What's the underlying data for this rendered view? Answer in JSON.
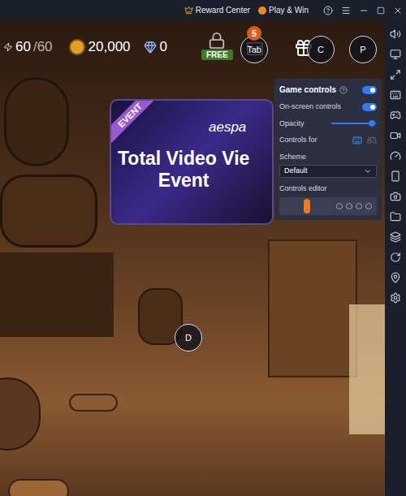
{
  "topbar": {
    "items": [
      {
        "label": "Reward Center"
      },
      {
        "label": "Play & Win"
      }
    ]
  },
  "hud": {
    "stamina": "60",
    "stamina_max": "/60",
    "gold": "20,000",
    "crystals": "0",
    "pack": "FREE",
    "mail_badge": "5"
  },
  "keys": [
    {
      "label": "Tab"
    },
    {
      "label": "C"
    },
    {
      "label": "P"
    },
    {
      "label": "D"
    }
  ],
  "banner": {
    "tag": "EVENT",
    "brand": "aespa",
    "title_lines": [
      "Total Video Vie",
      "Event"
    ]
  },
  "controls_panel": {
    "title": "Game controls",
    "enabled": true,
    "rows": [
      {
        "kind": "toggle",
        "label": "On-screen controls",
        "on": true
      },
      {
        "kind": "slider",
        "label": "Opacity",
        "level": 0.9
      },
      {
        "kind": "device",
        "label": "Controls for",
        "options": [
          {
            "kind": "keyboard",
            "selected": true
          },
          {
            "kind": "gamepad",
            "selected": false
          }
        ]
      }
    ],
    "scheme": {
      "label": "Scheme",
      "value": "Default"
    },
    "editor": {
      "label": "Controls editor"
    }
  }
}
